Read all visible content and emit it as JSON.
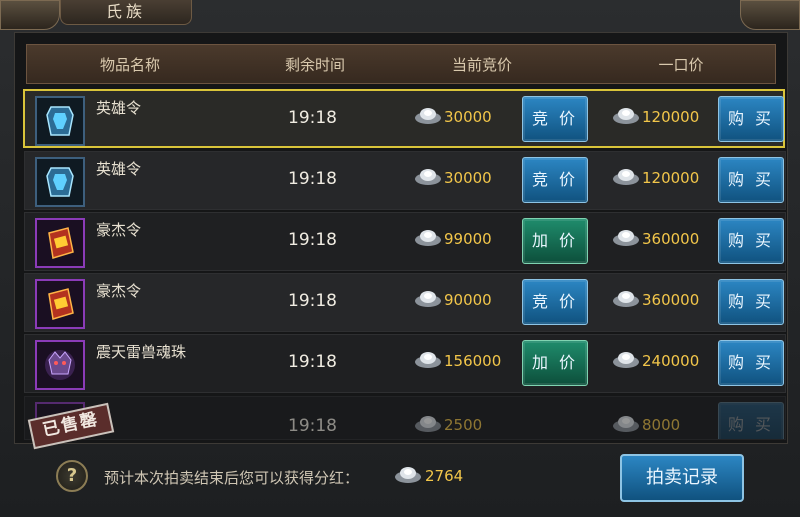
{
  "window": {
    "tab_title": "氏族"
  },
  "table": {
    "headers": [
      "物品名称",
      "剩余时间",
      "当前竞价",
      "一口价"
    ],
    "rows": [
      {
        "name": "英雄令",
        "time": "19:18",
        "bid": "30000",
        "bid_action": "竞 价",
        "price": "120000",
        "buy_action": "购 买",
        "rarity": "blue",
        "item_icon": "hero-token-icon",
        "selected": true
      },
      {
        "name": "英雄令",
        "time": "19:18",
        "bid": "30000",
        "bid_action": "竞 价",
        "price": "120000",
        "buy_action": "购 买",
        "rarity": "blue",
        "item_icon": "hero-token-icon"
      },
      {
        "name": "豪杰令",
        "time": "19:18",
        "bid": "99000",
        "bid_action": "加 价",
        "price": "360000",
        "buy_action": "购 买",
        "rarity": "purple",
        "item_icon": "champion-token-icon"
      },
      {
        "name": "豪杰令",
        "time": "19:18",
        "bid": "90000",
        "bid_action": "竞 价",
        "price": "360000",
        "buy_action": "购 买",
        "rarity": "purple",
        "item_icon": "champion-token-icon"
      },
      {
        "name": "震天雷兽魂珠",
        "time": "19:18",
        "bid": "156000",
        "bid_action": "加 价",
        "price": "240000",
        "buy_action": "购 买",
        "rarity": "purple",
        "item_icon": "beast-soul-orb-icon"
      },
      {
        "name": "",
        "time": "19:18",
        "bid": "2500",
        "price": "8000",
        "buy_action": "购 买",
        "sold_stamp": "已售罄"
      }
    ]
  },
  "footer": {
    "estimate_text": "预计本次拍卖结束后您可以获得分红：",
    "estimate_value": "2764",
    "record_button": "拍卖记录",
    "help_symbol": "?"
  },
  "colors": {
    "gold_text": "#f2c64a",
    "blue_button": "#1c6da3",
    "green_button": "#1a7b5e",
    "selected_border": "#d9c43a",
    "header_brown": "#4b3a2c"
  },
  "icons": [
    "silver-ingot-icon",
    "help-icon",
    "hero-token-icon",
    "champion-token-icon",
    "beast-soul-orb-icon"
  ]
}
